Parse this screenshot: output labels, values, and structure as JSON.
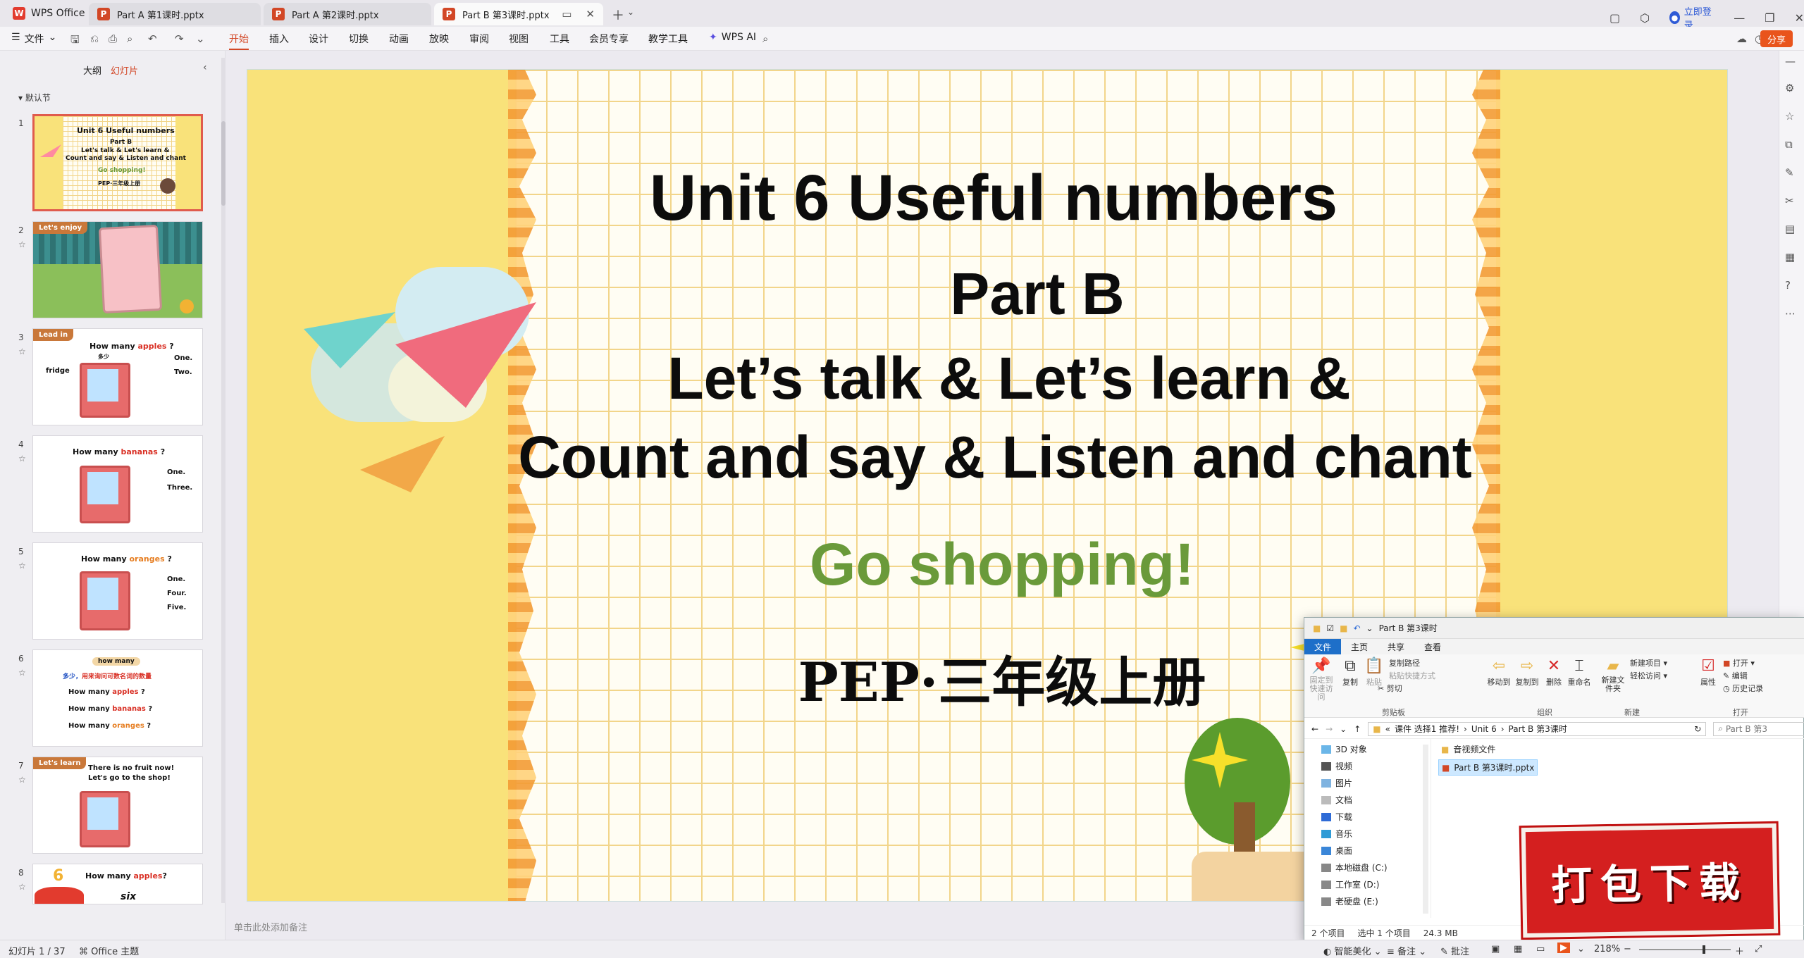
{
  "app": {
    "name": "WPS Office"
  },
  "tabs": [
    {
      "label": "Part A 第1课时.pptx"
    },
    {
      "label": "Part A 第2课时.pptx"
    },
    {
      "label": "Part B 第3课时.pptx"
    }
  ],
  "account": {
    "login": "立即登录"
  },
  "menu": {
    "file": "文件",
    "items": [
      "开始",
      "插入",
      "设计",
      "切换",
      "动画",
      "放映",
      "审阅",
      "视图",
      "工具",
      "会员专享",
      "教学工具"
    ],
    "ai": "WPS AI",
    "share": "分享"
  },
  "leftpanel": {
    "tab_outline": "大纲",
    "tab_slides": "幻灯片",
    "section": "默认节"
  },
  "thumbs": {
    "t1": {
      "l1": "Unit 6 Useful numbers",
      "l2": "Part B",
      "l3": "Let's talk & Let's learn &",
      "l4": "Count and say & Listen and chant",
      "l5": "Go shopping!",
      "l6": "PEP·三年级上册"
    },
    "t2": {
      "badge": "Let's enjoy"
    },
    "t3": {
      "badge": "Lead in",
      "q1": "How many",
      "q2": "apples",
      "q3": "?",
      "cn": "多少",
      "w": "fridge",
      "a1": "One.",
      "a2": "Two."
    },
    "t4": {
      "q1": "How many",
      "q2": "bananas",
      "q3": "?",
      "a1": "One.",
      "a2": "Three."
    },
    "t5": {
      "q1": "How many",
      "q2": "oranges",
      "q3": "?",
      "a1": "One.",
      "a2": "Four.",
      "a3": "Five."
    },
    "t6": {
      "tag": "how many",
      "cn1": "多少，",
      "cn2": "用来询问可数名词的数量",
      "l1a": "How many",
      "l1b": "apples",
      "l1c": "?",
      "l2a": "How many",
      "l2b": "bananas",
      "l2c": "?",
      "l3a": "How many",
      "l3b": "oranges",
      "l3c": "?"
    },
    "t7": {
      "badge": "Let's learn",
      "l1": "There is no fruit now!",
      "l2": "Let's go to the shop!"
    },
    "t8": {
      "num": "6",
      "q1": "How many",
      "q2": "apples",
      "q3": "?",
      "w": "six"
    }
  },
  "slide": {
    "title": "Unit 6 Useful numbers",
    "part": "Part B",
    "line1": "Let’s talk & Let’s learn &",
    "line2": "Count and say & Listen and chant",
    "subtitle": "Go shopping!",
    "grade": "PEP·三年级上册"
  },
  "notes_placeholder": "单击此处添加备注",
  "explorer": {
    "title": "Part B 第3课时",
    "tabs": [
      "文件",
      "主页",
      "共享",
      "查看"
    ],
    "ribbon": {
      "pin": "固定到快速访问",
      "copy": "复制",
      "paste": "粘贴",
      "copy_path": "复制路径",
      "paste_shortcut": "粘贴快捷方式",
      "cut": "剪切",
      "clipboard": "剪贴板",
      "move_to": "移动到",
      "copy_to": "复制到",
      "delete": "删除",
      "rename": "重命名",
      "organize": "组织",
      "new_folder": "新建文件夹",
      "new_item": "新建项目",
      "easy_access": "轻松访问",
      "new": "新建",
      "properties": "属性",
      "open": "打开",
      "edit": "编辑",
      "history": "历史记录",
      "open_grp": "打开"
    },
    "path": [
      "课件 选择1 推荐!",
      "Unit 6",
      "Part B 第3课时"
    ],
    "search": "Part B 第3",
    "nav": [
      "3D 对象",
      "视频",
      "图片",
      "文档",
      "下载",
      "音乐",
      "桌面",
      "本地磁盘 (C:)",
      "工作室 (D:)",
      "老硬盘 (E:)"
    ],
    "files": [
      "音视频文件",
      "Part B 第3课时.pptx"
    ],
    "status": {
      "count": "2 个项目",
      "selected": "选中 1 个项目",
      "size": "24.3 MB"
    }
  },
  "download_badge": "打包下载",
  "statusbar": {
    "slide_pos": "幻灯片 1 / 37",
    "theme": "Office 主题",
    "smart": "智能美化",
    "notes": "备注",
    "comment": "批注",
    "zoom": "218%"
  },
  "colors": {
    "accent": "#d24726",
    "slide_subtitle": "#6a9a3a",
    "badge_bg": "#d41f1f"
  }
}
